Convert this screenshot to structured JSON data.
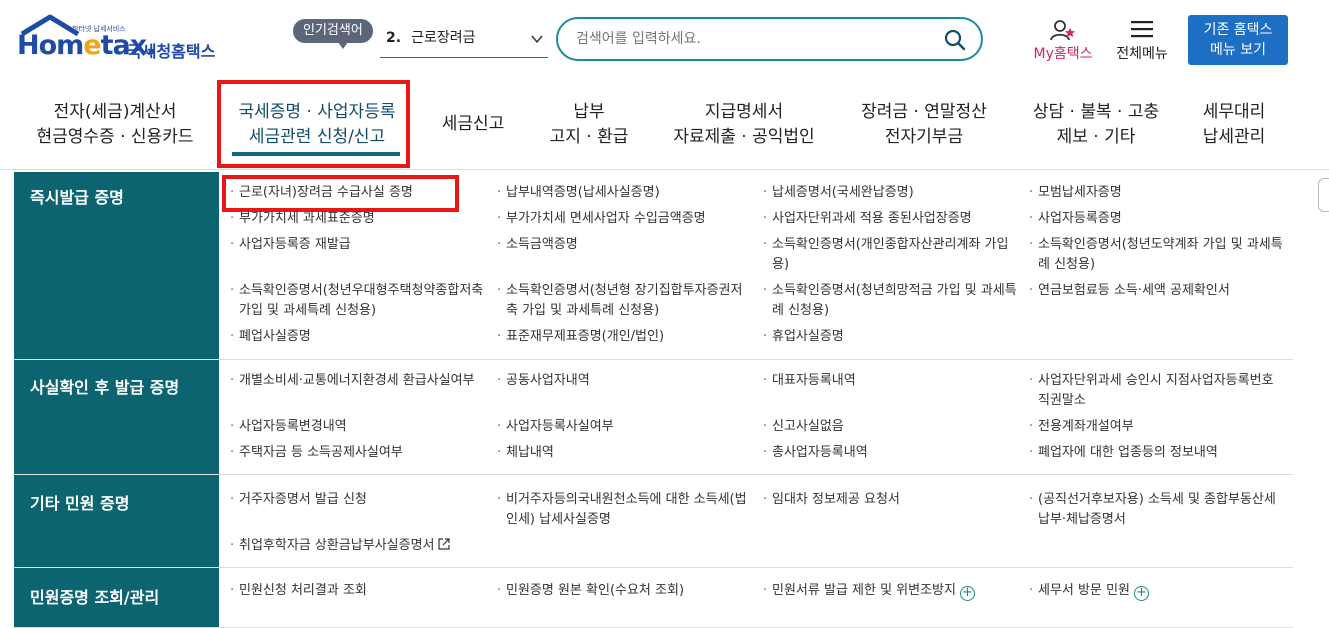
{
  "header": {
    "logo_small": "한터넷 납세서비스",
    "logo_home_prefix": "Hom",
    "logo_home_e": "e",
    "logo_home_suffix": "tax.",
    "logo_kr": "국세청홈택스",
    "popular_badge": "인기검색어",
    "popular_num": "2.",
    "popular_term": "근로장려금",
    "search_placeholder": "검색어를 입력하세요.",
    "myhome_label": "My홈택스",
    "allmenu_label": "전체메뉴",
    "old_menu_line1": "기존 홈택스",
    "old_menu_line2": "메뉴 보기"
  },
  "nav": [
    {
      "line1": "전자(세금)계산서",
      "line2": "현금영수증 · 신용카드"
    },
    {
      "line1": "국세증명 · 사업자등록",
      "line2": "세금관련 신청/신고"
    },
    {
      "line1": "세금신고",
      "line2": ""
    },
    {
      "line1": "납부",
      "line2": "고지 · 환급"
    },
    {
      "line1": "지급명세서",
      "line2": "자료제출 · 공익법인"
    },
    {
      "line1": "장려금 · 연말정산",
      "line2": "전자기부금"
    },
    {
      "line1": "상담 · 불복 · 고충",
      "line2": "제보 · 기타"
    },
    {
      "line1": "세무대리",
      "line2": "납세관리"
    }
  ],
  "sections": [
    {
      "category": "즉시발급 증명",
      "items": [
        "근로(자녀)장려금 수급사실 증명",
        "납부내역증명(납세사실증명)",
        "납세증명서(국세완납증명)",
        "모범납세자증명",
        "부가가치세 과세표준증명",
        "부가가치세 면세사업자 수입금액증명",
        "사업자단위과세 적용 종된사업장증명",
        "사업자등록증명",
        "사업자등록증 재발급",
        "소득금액증명",
        "소득확인증명서(개인종합자산관리계좌 가입용)",
        "소득확인증명서(청년도약계좌 가입 및 과세특례 신청용)",
        "소득확인증명서(청년우대형주택청약종합저축 가입 및 과세특례 신청용)",
        "소득확인증명서(청년형 장기집합투자증권저축 가입 및 과세특례 신청용)",
        "소득확인증명서(청년희망적금 가입 및 과세특례 신청용)",
        "연금보험료등 소득·세액 공제확인서",
        "폐업사실증명",
        "표준재무제표증명(개인/법인)",
        "휴업사실증명"
      ]
    },
    {
      "category": "사실확인 후 발급 증명",
      "items": [
        "개별소비세·교통에너지환경세 환급사실여부",
        "공동사업자내역",
        "대표자등록내역",
        "사업자단위과세 승인시 지점사업자등록번호 직권말소",
        "사업자등록변경내역",
        "사업자등록사실여부",
        "신고사실없음",
        "전용계좌개설여부",
        "주택자금 등 소득공제사실여부",
        "체납내역",
        "총사업자등록내역",
        "폐업자에 대한 업종등의 정보내역"
      ]
    },
    {
      "category": "기타 민원 증명",
      "items": [
        "거주자증명서 발급 신청",
        "비거주자등의국내원천소득에 대한 소득세(법인세) 납세사실증명",
        "임대차 정보제공 요청서",
        "(공직선거후보자용) 소득세 및 종합부동산세 납부·체납증명서",
        "취업후학자금 상환금납부사실증명서"
      ]
    },
    {
      "category": "민원증명 조회/관리",
      "items": [
        "민원신청 처리결과 조회",
        "민원증명 원본 확인(수요처 조회)",
        "민원서류 발급 제한 및 위변조방지",
        "세무서 방문 민원"
      ]
    }
  ]
}
